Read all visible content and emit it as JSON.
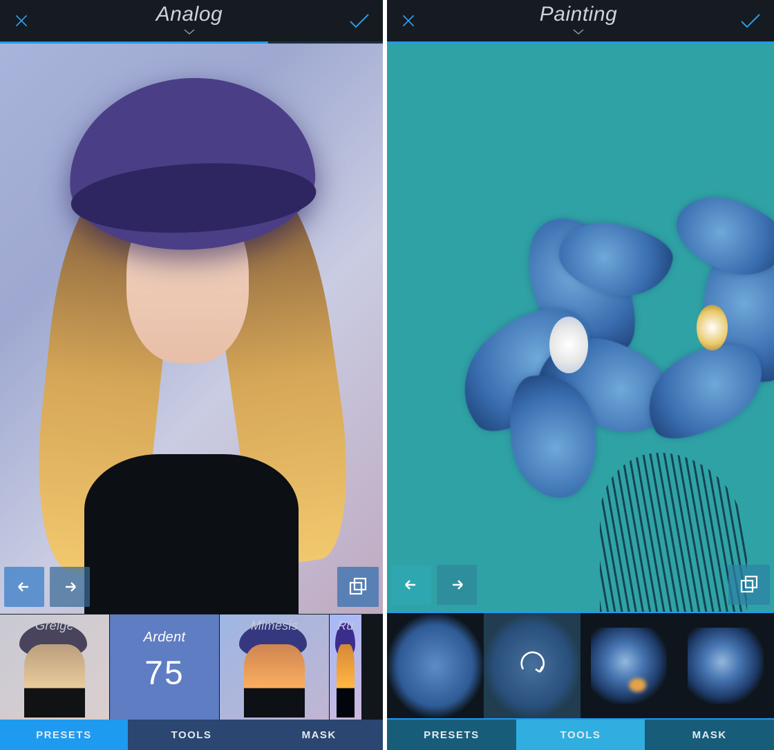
{
  "left": {
    "header": {
      "title": "Analog"
    },
    "progress_pct": 70,
    "presets": [
      {
        "key": "greige",
        "label": "Greige"
      },
      {
        "key": "ardent",
        "label": "Ardent",
        "selected": true,
        "value": "75"
      },
      {
        "key": "mimesis",
        "label": "Mimesis"
      },
      {
        "key": "ru",
        "label": "Ru"
      }
    ],
    "tabs": {
      "presets": "PRESETS",
      "tools": "TOOLS",
      "mask": "MASK",
      "active": "presets"
    }
  },
  "right": {
    "header": {
      "title": "Painting"
    },
    "progress_pct": 100,
    "tabs": {
      "presets": "PRESETS",
      "tools": "TOOLS",
      "mask": "MASK",
      "active": "tools"
    }
  }
}
